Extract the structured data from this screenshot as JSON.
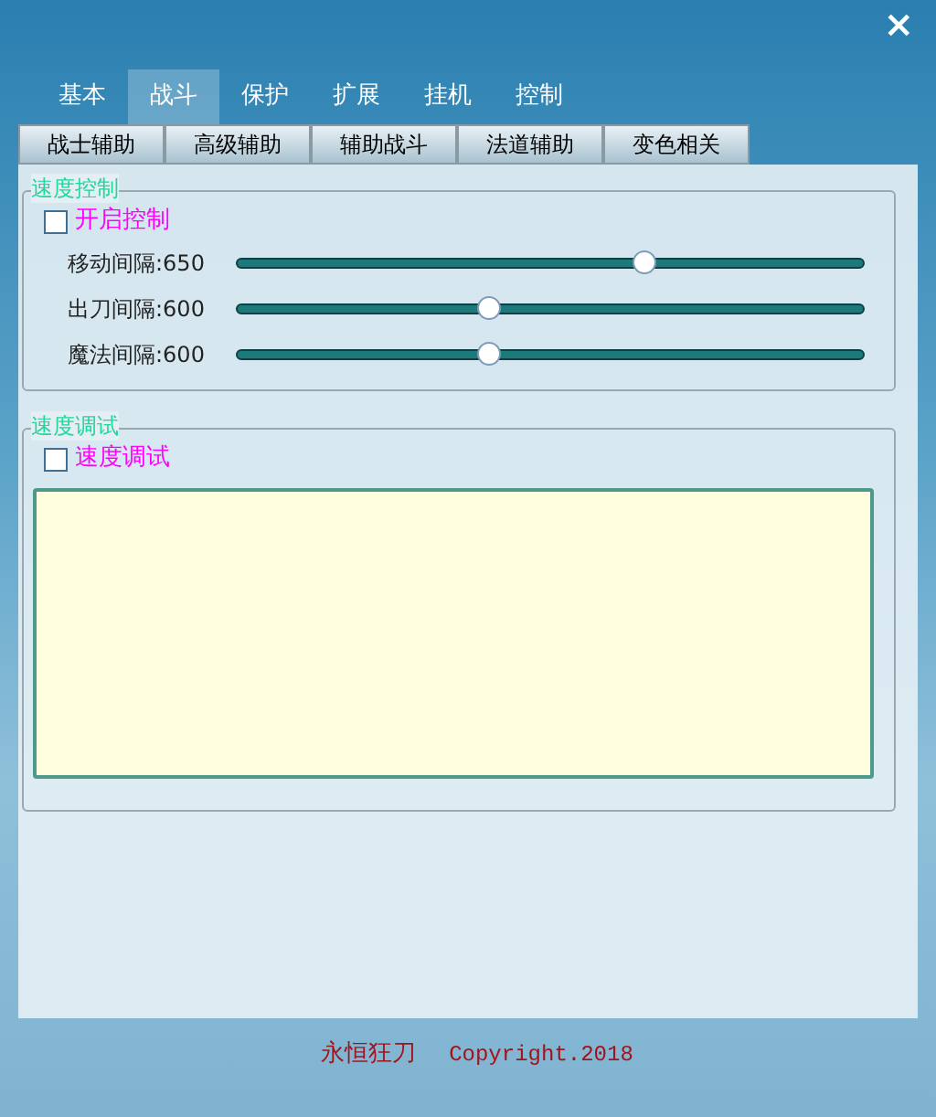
{
  "close_button": "×",
  "tabs": [
    {
      "label": "基本",
      "selected": false
    },
    {
      "label": "战斗",
      "selected": true
    },
    {
      "label": "保护",
      "selected": false
    },
    {
      "label": "扩展",
      "selected": false
    },
    {
      "label": "挂机",
      "selected": false
    },
    {
      "label": "控制",
      "selected": false
    }
  ],
  "sub_tabs": [
    {
      "label": "战士辅助",
      "selected": false
    },
    {
      "label": "高级辅助",
      "selected": false
    },
    {
      "label": "辅助战斗",
      "selected": false
    },
    {
      "label": "法道辅助",
      "selected": false
    },
    {
      "label": "变色相关",
      "selected": false
    }
  ],
  "speed_control": {
    "title": "速度控制",
    "checkbox": {
      "label": "开启控制",
      "checked": false
    },
    "sliders": [
      {
        "label": "移动间隔:650",
        "level": 0.65
      },
      {
        "label": "出刀间隔:600",
        "level": 0.4
      },
      {
        "label": "魔法间隔:600",
        "level": 0.4
      }
    ]
  },
  "speed_debug": {
    "title": "速度调试",
    "checkbox": {
      "label": "速度调试",
      "checked": false
    }
  },
  "footer": {
    "name": "永恒狂刀",
    "copyright": "Copyright.2018"
  }
}
